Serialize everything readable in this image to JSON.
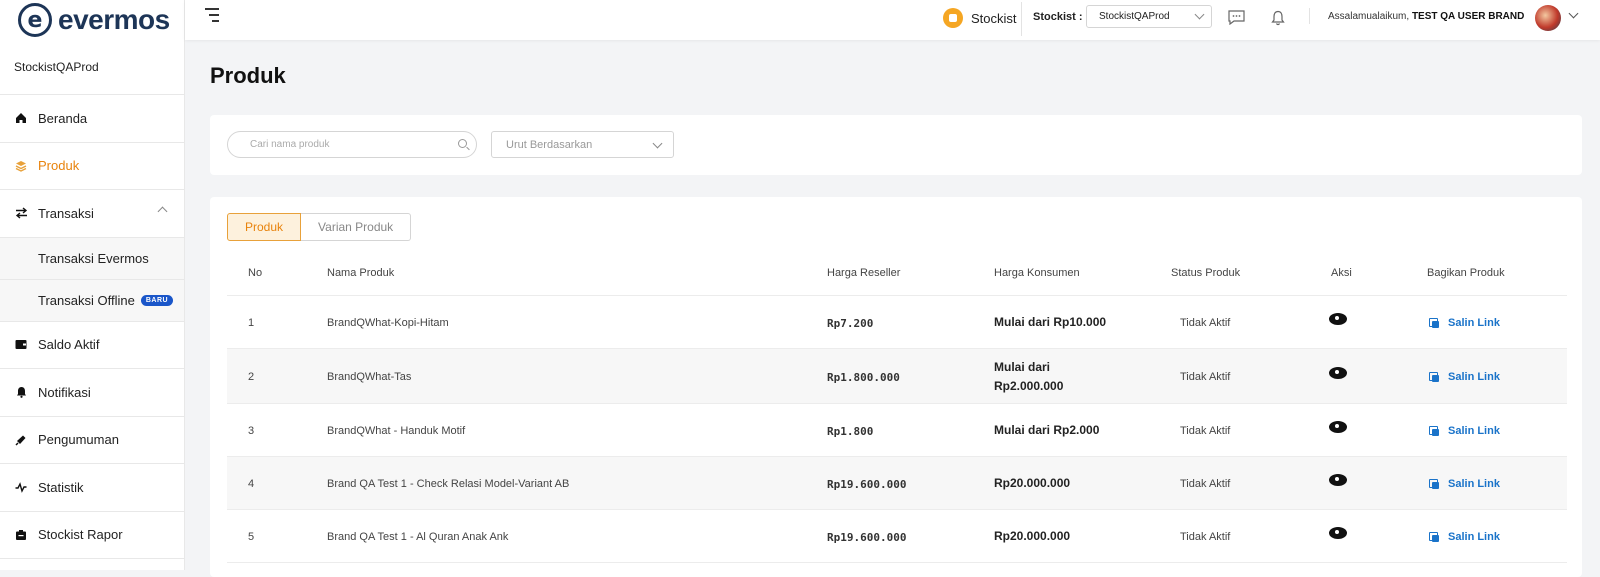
{
  "brand": {
    "name": "evermos"
  },
  "sidebar": {
    "store_name": "StockistQAProd",
    "items": [
      {
        "label": "Beranda",
        "icon": "home-icon"
      },
      {
        "label": "Produk",
        "icon": "layers-icon",
        "active": true
      },
      {
        "label": "Transaksi",
        "icon": "swap-icon",
        "expanded": true
      },
      {
        "label": "Saldo Aktif",
        "icon": "wallet-icon"
      },
      {
        "label": "Notifikasi",
        "icon": "bell-icon"
      },
      {
        "label": "Pengumuman",
        "icon": "megaphone-icon"
      },
      {
        "label": "Statistik",
        "icon": "chart-line-icon"
      },
      {
        "label": "Stockist Rapor",
        "icon": "report-icon"
      }
    ],
    "sub_items": [
      {
        "label": "Transaksi Evermos"
      },
      {
        "label": "Transaksi Offline",
        "badge": "BARU"
      }
    ]
  },
  "header": {
    "role": "Stockist",
    "stockist_label": "Stockist :",
    "stockist_value": "StockistQAProd",
    "greeting": "Assalamualaikum,",
    "user_name": "TEST QA USER BRAND"
  },
  "page": {
    "title": "Produk",
    "search_placeholder": "Cari nama produk",
    "sort_placeholder": "Urut Berdasarkan",
    "tabs": [
      "Produk",
      "Varian Produk"
    ],
    "columns": [
      "No",
      "Nama Produk",
      "Harga Reseller",
      "Harga Konsumen",
      "Status Produk",
      "Aksi",
      "Bagikan Produk"
    ],
    "copy_label": "Salin Link",
    "rows": [
      {
        "no": "1",
        "name": "BrandQWhat-Kopi-Hitam",
        "reseller": "Rp7.200",
        "consumer": "Mulai dari Rp10.000",
        "status": "Tidak Aktif"
      },
      {
        "no": "2",
        "name": "BrandQWhat-Tas",
        "reseller": "Rp1.800.000",
        "consumer": "Mulai dari Rp2.000.000",
        "status": "Tidak Aktif"
      },
      {
        "no": "3",
        "name": "BrandQWhat - Handuk Motif",
        "reseller": "Rp1.800",
        "consumer": "Mulai dari Rp2.000",
        "status": "Tidak Aktif"
      },
      {
        "no": "4",
        "name": "Brand QA Test 1 - Check Relasi Model-Variant AB",
        "reseller": "Rp19.600.000",
        "consumer": "Rp20.000.000",
        "status": "Tidak Aktif"
      },
      {
        "no": "5",
        "name": "Brand QA Test 1 - Al Quran Anak Ank",
        "reseller": "Rp19.600.000",
        "consumer": "Rp20.000.000",
        "status": "Tidak Aktif"
      }
    ]
  }
}
